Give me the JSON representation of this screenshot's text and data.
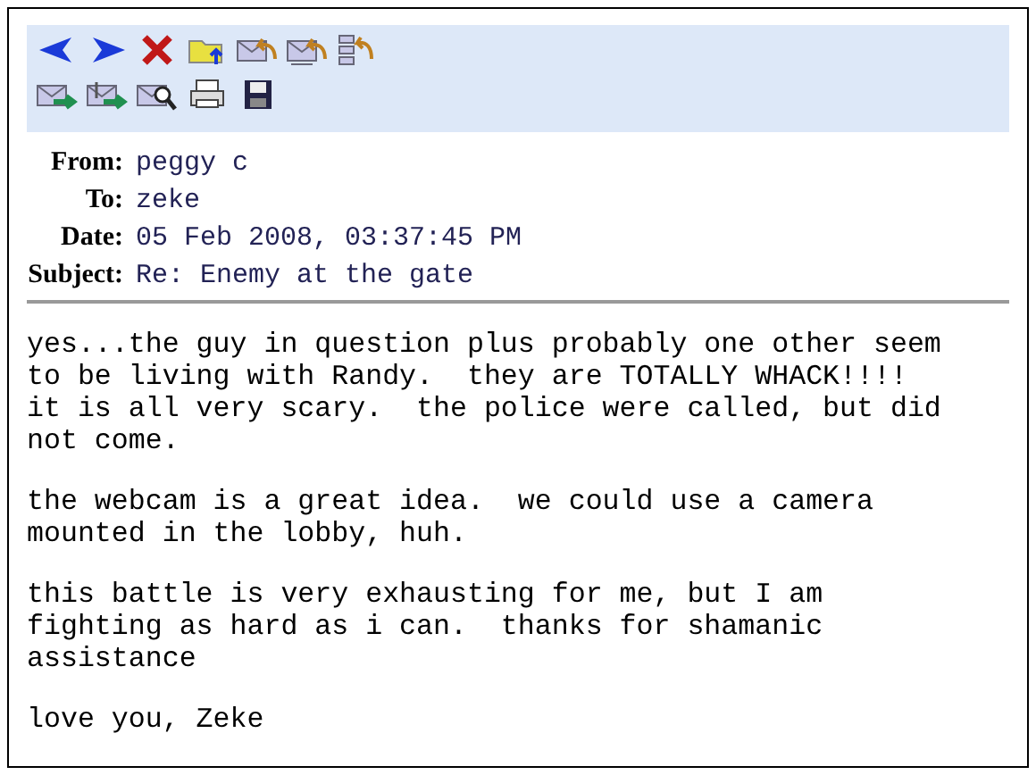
{
  "headers": [
    {
      "label": "From:",
      "value": "peggy c"
    },
    {
      "label": "To:",
      "value": "zeke"
    },
    {
      "label": "Date:",
      "value": "05 Feb 2008, 03:37:45 PM"
    },
    {
      "label": "Subject:",
      "value": "Re: Enemy at the gate"
    }
  ],
  "body": [
    "yes...the guy in question plus probably one other seem\nto be living with Randy.  they are TOTALLY WHACK!!!!\nit is all very scary.  the police were called, but did\nnot come.",
    "the webcam is a great idea.  we could use a camera\nmounted in the lobby, huh.",
    "this battle is very exhausting for me, but I am\nfighting as hard as i can.  thanks for shamanic\nassistance",
    "love you, Zeke"
  ]
}
